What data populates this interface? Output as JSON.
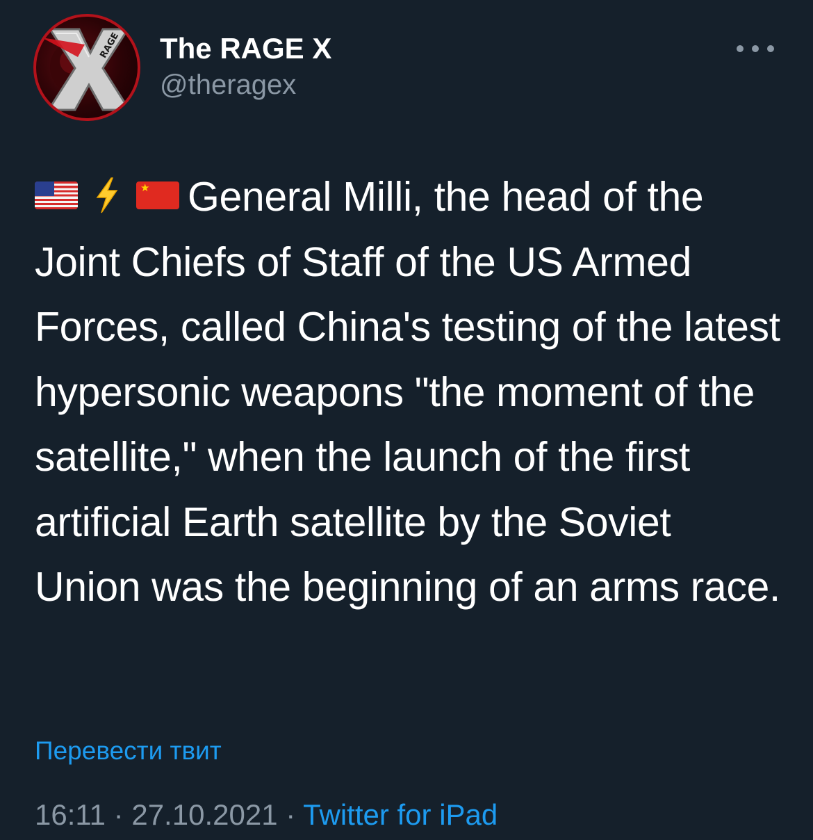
{
  "author": {
    "display_name": "The RAGE X",
    "handle": "@theragex",
    "avatar_text": "RAGE"
  },
  "tweet": {
    "emojis": [
      "flag-us",
      "lightning",
      "flag-cn"
    ],
    "text": "General Milli, the head of the Joint Chiefs of Staff of the US Armed Forces, called China's testing of the latest hypersonic weapons \"the moment of the satellite,\" when the launch of the first artificial Earth satellite by the Soviet Union was the beginning of an arms race."
  },
  "translate_label": "Перевести твит",
  "meta": {
    "time": "16:11",
    "separator": "·",
    "date": "27.10.2021",
    "source": "Twitter for iPad"
  },
  "colors": {
    "background": "#15202b",
    "text": "#ffffff",
    "secondary": "#8b98a5",
    "link": "#1d9bf0",
    "avatar_ring": "#b3121b"
  }
}
